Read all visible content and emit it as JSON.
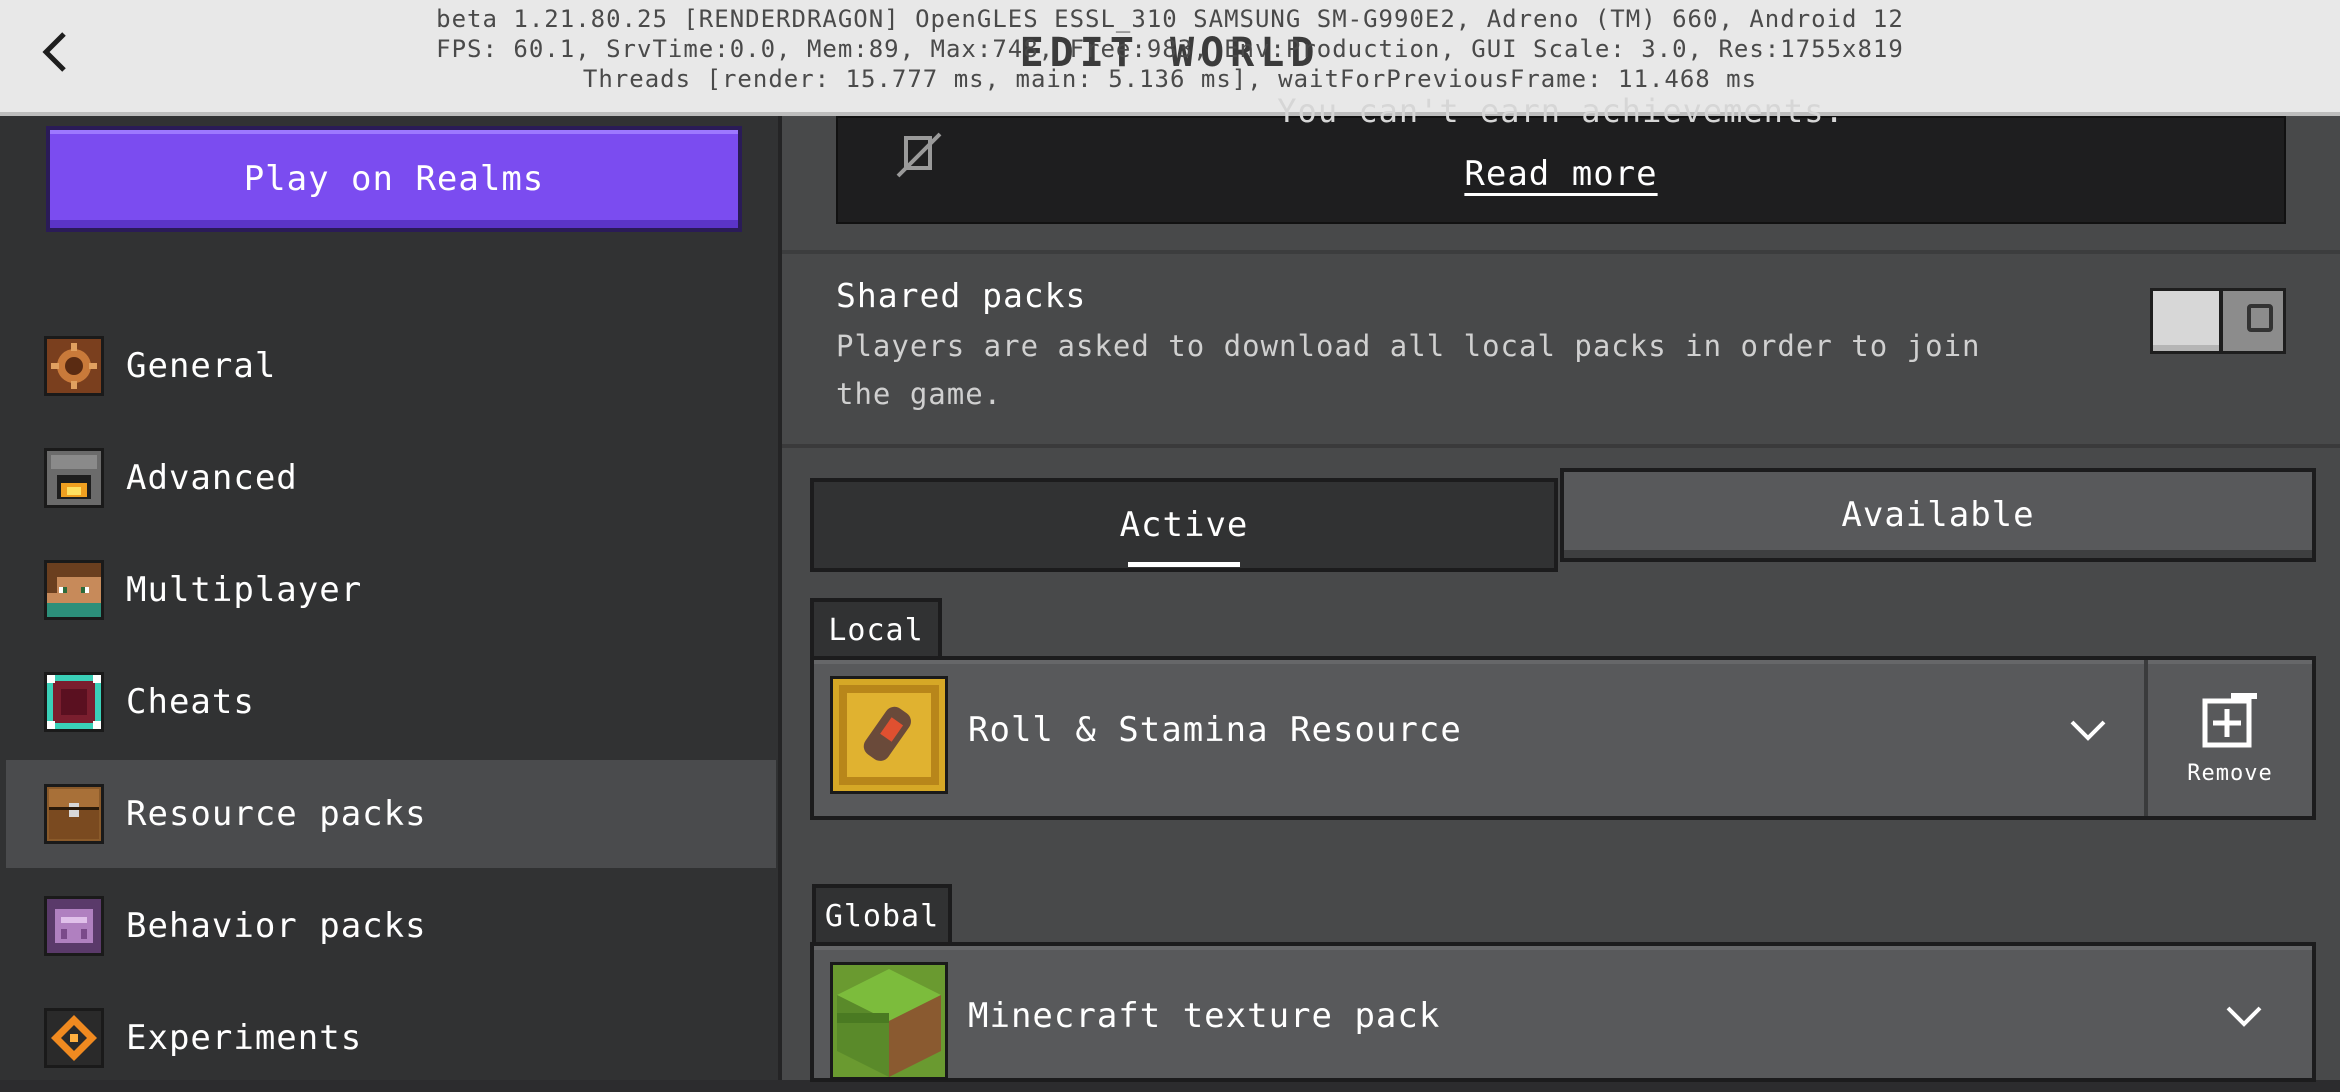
{
  "header": {
    "back_icon": "chevron-left-icon",
    "title": "EDIT WORLD",
    "debug_line_1": "beta 1.21.80.25 [RENDERDRAGON] OpenGLES ESSL_310 SAMSUNG SM-G990E2, Adreno (TM) 660, Android 12",
    "debug_line_2": "FPS: 60.1, SrvTime:0.0, Mem:89, Max:748, Free:983, Env:Production, GUI Scale: 3.0, Res:1755x819",
    "debug_line_3": "Threads [render: 15.777 ms, main: 5.136 ms], waitForPreviousFrame: 11.468 ms"
  },
  "sidebar": {
    "realms_button": "Play on Realms",
    "items": [
      {
        "label": "General",
        "icon": "gear-icon",
        "selected": false
      },
      {
        "label": "Advanced",
        "icon": "furnace-icon",
        "selected": false
      },
      {
        "label": "Multiplayer",
        "icon": "player-head-icon",
        "selected": false
      },
      {
        "label": "Cheats",
        "icon": "command-block-icon",
        "selected": false
      },
      {
        "label": "Resource packs",
        "icon": "chest-icon",
        "selected": true
      },
      {
        "label": "Behavior packs",
        "icon": "behavior-icon",
        "selected": false
      },
      {
        "label": "Experiments",
        "icon": "experiment-icon",
        "selected": false
      }
    ]
  },
  "main": {
    "notice_partial_text": "You can't earn achievements.",
    "notice_icon": "no-achievements-icon",
    "read_more": "Read more",
    "shared_packs": {
      "title": "Shared packs",
      "description": "Players are asked to download all local packs in order to join the game.",
      "toggle_on": false
    },
    "tabs": [
      {
        "label": "Active",
        "active": true
      },
      {
        "label": "Available",
        "active": false
      }
    ],
    "local_label": "Local",
    "global_label": "Global",
    "local_pack": {
      "name": "Roll & Stamina Resource",
      "remove_label": "Remove"
    },
    "global_pack": {
      "name": "Minecraft texture pack"
    }
  },
  "colors": {
    "realms_purple": "#7b4cf0",
    "sidebar_bg": "#313233",
    "main_bg": "#48494a",
    "topbar_bg": "#e8e8e8"
  }
}
